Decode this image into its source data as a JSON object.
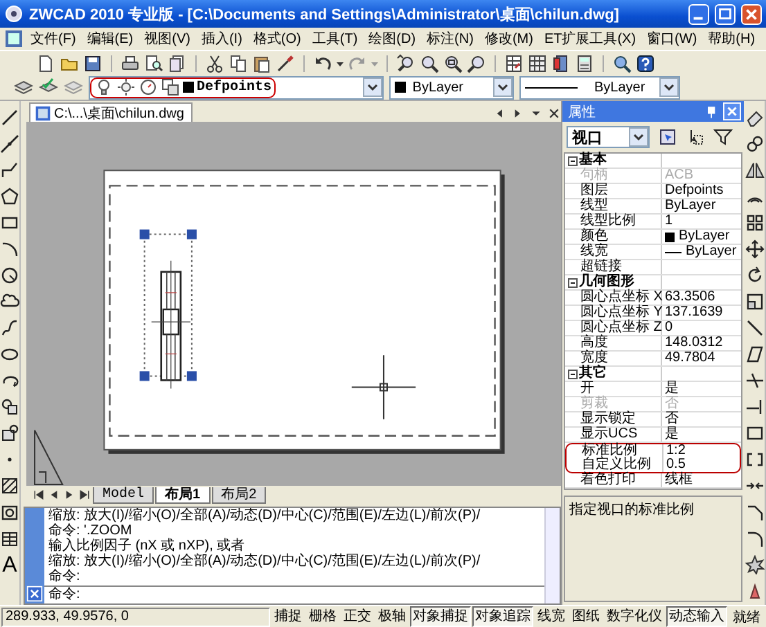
{
  "window": {
    "title": "ZWCAD 2010 专业版 - [C:\\Documents and Settings\\Administrator\\桌面\\chilun.dwg]"
  },
  "menu": [
    "文件(F)",
    "编辑(E)",
    "视图(V)",
    "插入(I)",
    "格式(O)",
    "工具(T)",
    "绘图(D)",
    "标注(N)",
    "修改(M)",
    "ET扩展工具(X)",
    "窗口(W)",
    "帮助(H)"
  ],
  "layer_toolbar": {
    "layer": "Defpoints",
    "highlighted": true,
    "color_name": "ByLayer",
    "linetype": "ByLayer"
  },
  "document_tab": {
    "title": "C:\\...\\桌面\\chilun.dwg"
  },
  "draw_toolbar": {
    "text_tool": "A"
  },
  "layout_tabs": [
    {
      "label": "Model",
      "selected": false
    },
    {
      "label": "布局1",
      "selected": true
    },
    {
      "label": "布局2",
      "selected": false
    }
  ],
  "command_history": [
    "缩放:  放大(I)/缩小(O)/全部(A)/动态(D)/中心(C)/范围(E)/左边(L)/前次(P)/",
    "命令: '.ZOOM",
    "输入比例因子 (nX 或 nXP), 或者",
    "缩放:  放大(I)/缩小(O)/全部(A)/动态(D)/中心(C)/范围(E)/左边(L)/前次(P)/",
    "命令:"
  ],
  "command_prompt": "命令:",
  "properties": {
    "title": "属性",
    "object_type": "视口",
    "categories": [
      {
        "name": "基本",
        "expanded": true,
        "rows": [
          {
            "label": "句柄",
            "value": "ACB",
            "kind": "text",
            "disabled": true,
            "highlighted": false
          },
          {
            "label": "图层",
            "value": "Defpoints",
            "kind": "text",
            "disabled": false,
            "highlighted": false
          },
          {
            "label": "线型",
            "value": "ByLayer",
            "kind": "text",
            "disabled": false,
            "highlighted": false
          },
          {
            "label": "线型比例",
            "value": "1",
            "kind": "text",
            "disabled": false,
            "highlighted": false
          },
          {
            "label": "颜色",
            "value": "ByLayer",
            "kind": "color",
            "disabled": false,
            "highlighted": false
          },
          {
            "label": "线宽",
            "value": "ByLayer",
            "kind": "lineweight",
            "disabled": false,
            "highlighted": false
          },
          {
            "label": "超链接",
            "kind": "text",
            "disabled": false,
            "highlighted": false
          }
        ]
      },
      {
        "name": "几何图形",
        "expanded": true,
        "rows": [
          {
            "label": "圆心点坐标 X",
            "value": "63.3506",
            "kind": "text",
            "disabled": false,
            "highlighted": false
          },
          {
            "label": "圆心点坐标 Y",
            "value": "137.1639",
            "kind": "text",
            "disabled": false,
            "highlighted": false
          },
          {
            "label": "圆心点坐标 Z",
            "value": "0",
            "kind": "text",
            "disabled": false,
            "highlighted": false
          },
          {
            "label": "高度",
            "value": "148.0312",
            "kind": "text",
            "disabled": false,
            "highlighted": false
          },
          {
            "label": "宽度",
            "value": "49.7804",
            "kind": "text",
            "disabled": false,
            "highlighted": false
          }
        ]
      },
      {
        "name": "其它",
        "expanded": true,
        "rows": [
          {
            "label": "开",
            "value": "是",
            "kind": "text",
            "disabled": false,
            "highlighted": false
          },
          {
            "label": "剪裁",
            "value": "否",
            "kind": "text",
            "disabled": true,
            "highlighted": false
          },
          {
            "label": "显示锁定",
            "value": "否",
            "kind": "text",
            "disabled": false,
            "highlighted": false
          },
          {
            "label": "显示UCS",
            "value": "是",
            "kind": "text",
            "disabled": false,
            "highlighted": false
          },
          {
            "label": "标准比例",
            "value": "1:2",
            "kind": "text",
            "disabled": false,
            "highlighted": true
          },
          {
            "label": "自定义比例",
            "value": "0.5",
            "kind": "text",
            "disabled": false,
            "highlighted": true
          },
          {
            "label": "着色打印",
            "value": "线框",
            "kind": "text",
            "disabled": false,
            "highlighted": false
          }
        ]
      }
    ],
    "description": "指定视口的标准比例"
  },
  "status_bar": {
    "coordinates": "289.933, 49.9576, 0",
    "buttons": [
      {
        "label": "捕捉",
        "on": false
      },
      {
        "label": "栅格",
        "on": false
      },
      {
        "label": "正交",
        "on": false
      },
      {
        "label": "极轴",
        "on": false
      },
      {
        "label": "对象捕捉",
        "on": true
      },
      {
        "label": "对象追踪",
        "on": true
      },
      {
        "label": "线宽",
        "on": false
      },
      {
        "label": "图纸",
        "on": false
      },
      {
        "label": "数字化仪",
        "on": false
      },
      {
        "label": "动态输入",
        "on": true
      }
    ],
    "state": "就绪"
  }
}
